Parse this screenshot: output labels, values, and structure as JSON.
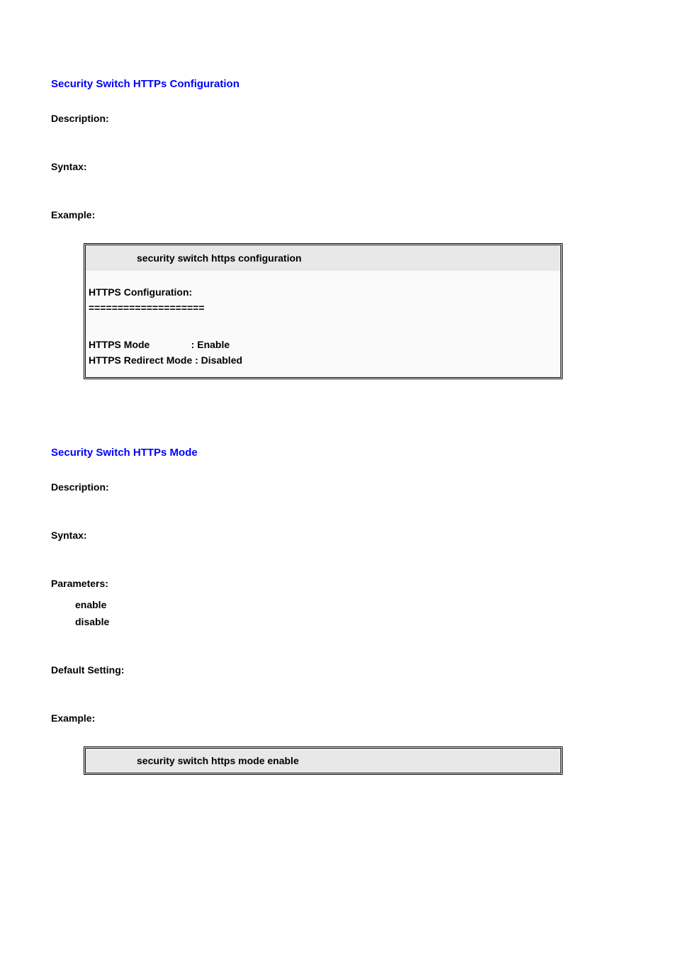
{
  "section1": {
    "title": "Security Switch HTTPs Configuration",
    "description_label": "Description:",
    "syntax_label": "Syntax:",
    "example_label": "Example:",
    "code": {
      "header": "security switch https configuration",
      "config_title": "HTTPS Configuration:",
      "separator": "====================",
      "mode_line": "HTTPS Mode               : Enable",
      "redirect_line": "HTTPS Redirect Mode : Disabled"
    }
  },
  "section2": {
    "title": "Security Switch HTTPs Mode",
    "description_label": "Description:",
    "syntax_label": "Syntax:",
    "parameters_label": "Parameters:",
    "param1": "enable",
    "param2": "disable",
    "default_label": "Default Setting:",
    "example_label": "Example:",
    "code": {
      "header": "security switch https mode enable"
    }
  }
}
